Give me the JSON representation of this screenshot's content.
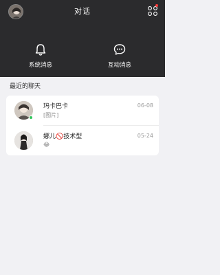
{
  "header": {
    "title": "对话",
    "actions": [
      {
        "label": "系统消息",
        "icon": "bell-icon"
      },
      {
        "label": "互动消息",
        "icon": "chat-bubble-icon"
      }
    ]
  },
  "section": {
    "title": "最近的聊天"
  },
  "conversations": [
    {
      "name": "玛卡巴卡",
      "preview": "[图片]",
      "date": "06-08",
      "online": true
    },
    {
      "name": "娜儿🚫技术型",
      "preview": "😂",
      "date": "05-24",
      "online": false
    }
  ],
  "colors": {
    "header_bg": "#2b2b2d",
    "online": "#2fc45a",
    "notification": "#ff3b3b"
  }
}
